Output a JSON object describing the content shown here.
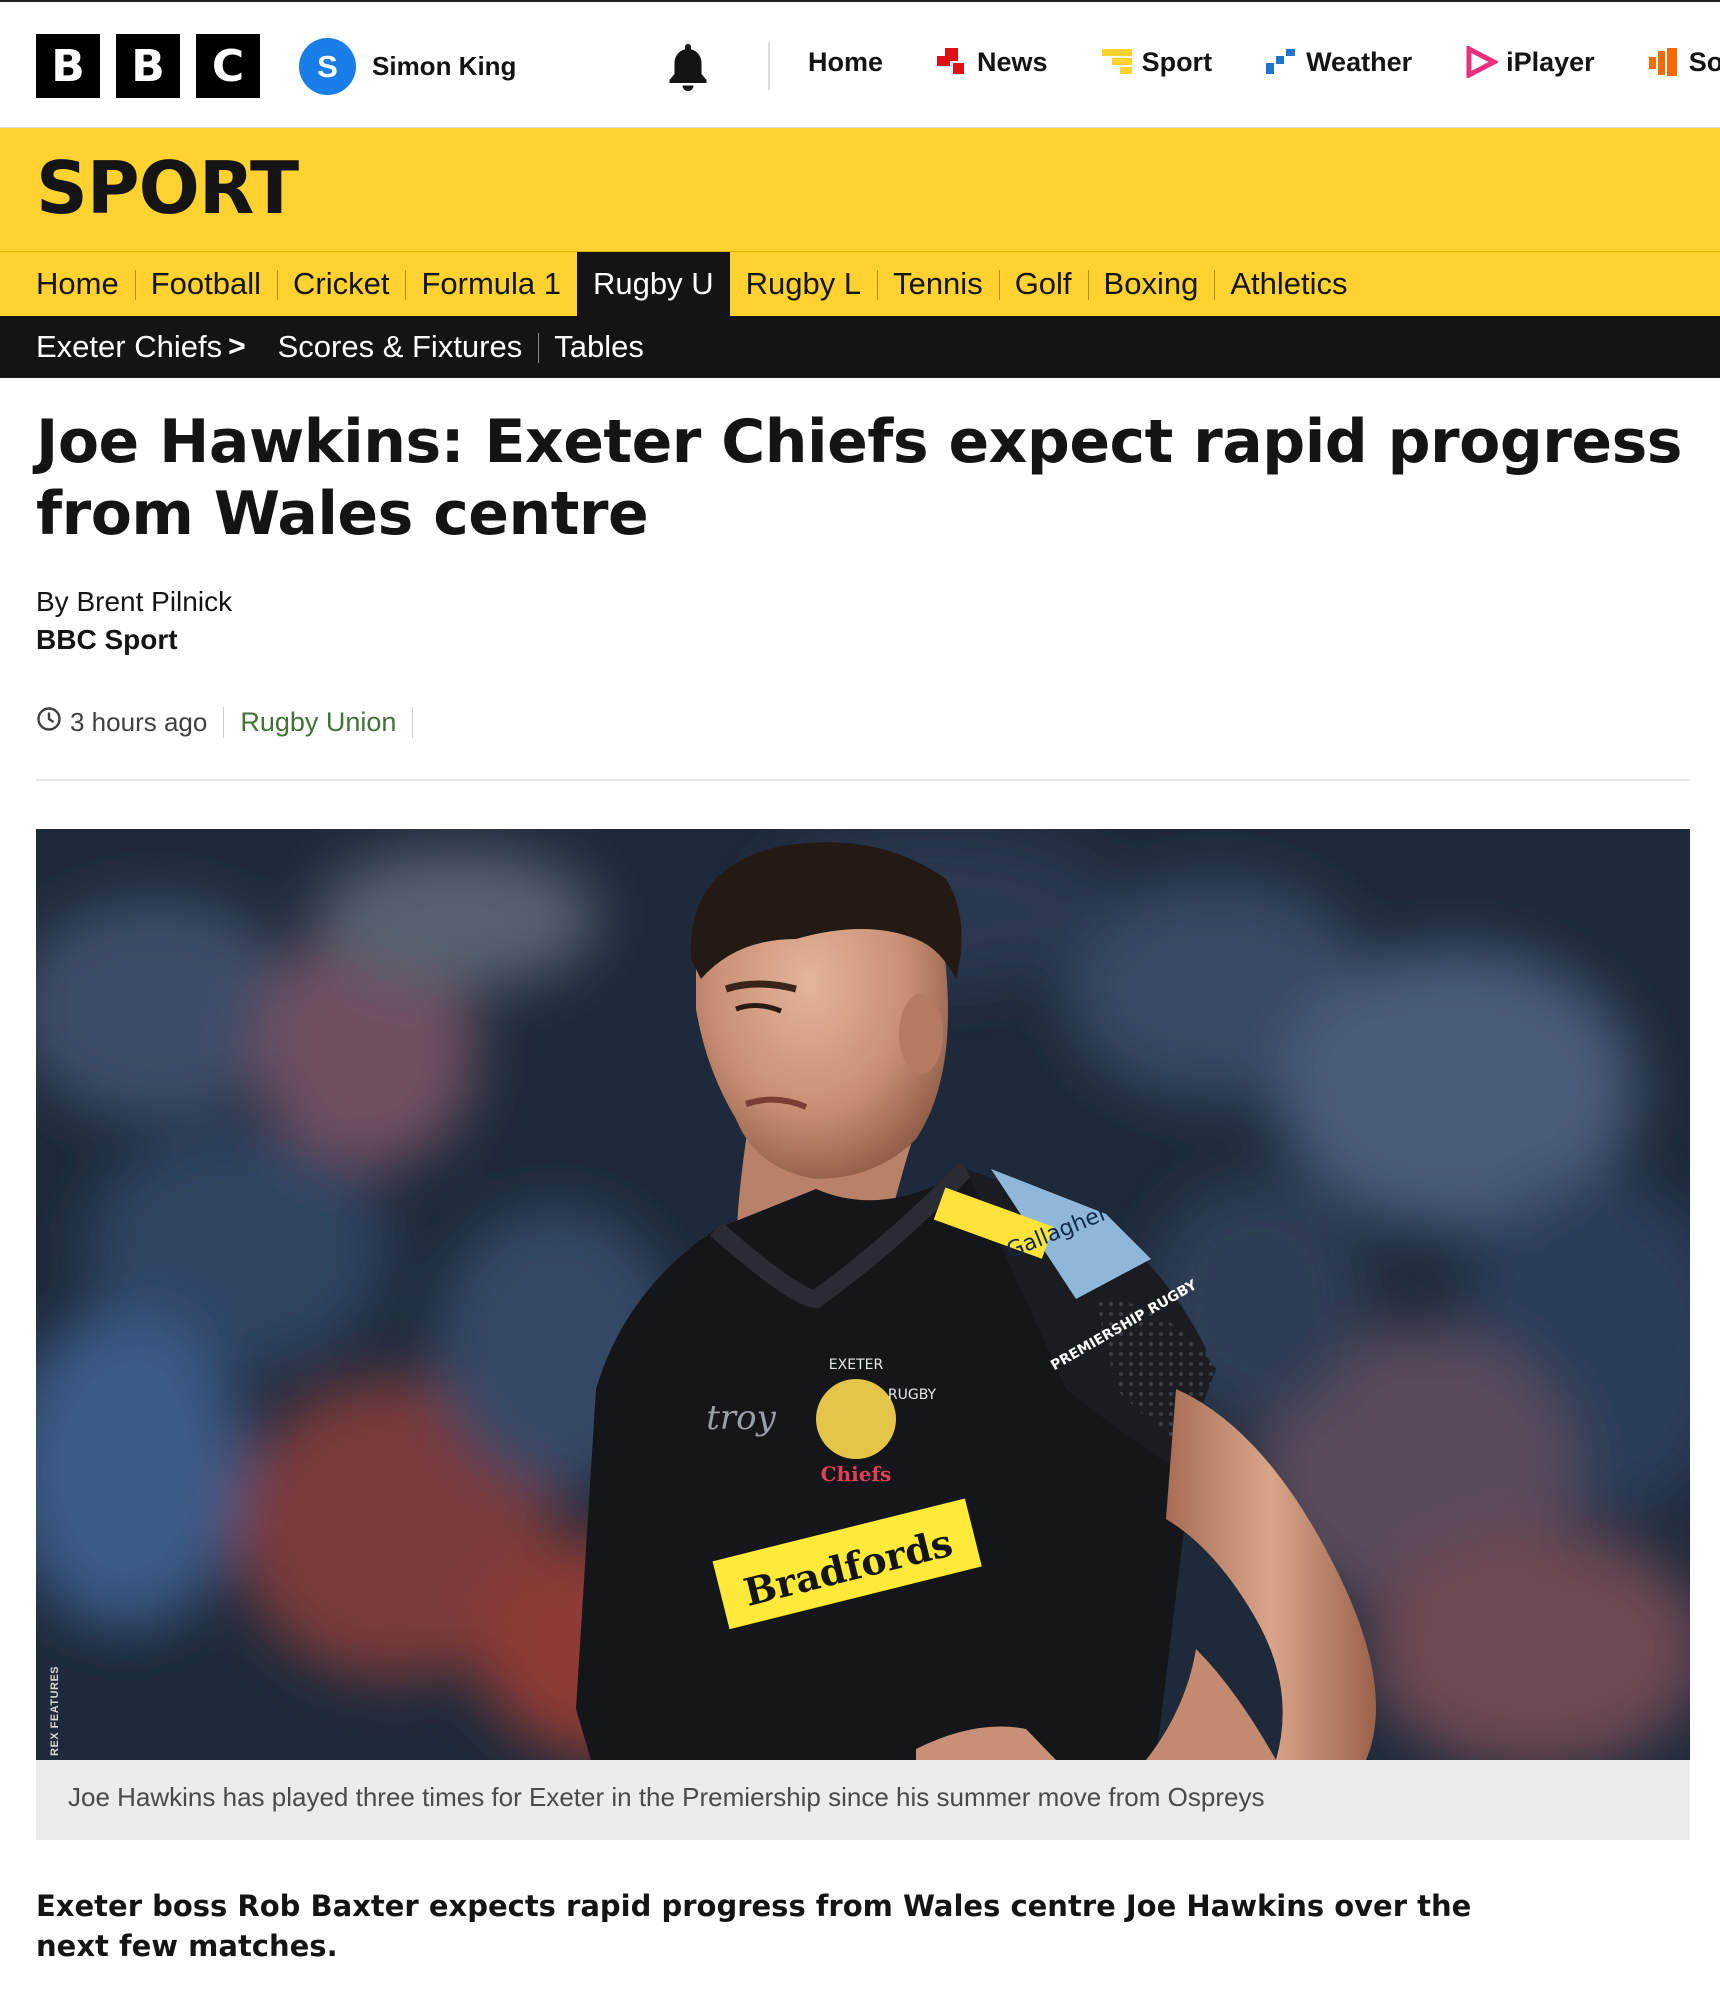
{
  "header": {
    "logo_letters": [
      "B",
      "B",
      "C"
    ],
    "account": {
      "initial": "S",
      "name": "Simon King"
    },
    "nav": [
      {
        "label": "Home",
        "icon": ""
      },
      {
        "label": "News",
        "icon": "news-icon",
        "color": "#e20f14"
      },
      {
        "label": "Sport",
        "icon": "sport-icon",
        "color": "#ffd230"
      },
      {
        "label": "Weather",
        "icon": "weather-icon",
        "color": "#1d75d1"
      },
      {
        "label": "iPlayer",
        "icon": "iplayer-icon",
        "color": "#e8317a"
      },
      {
        "label": "Sounds",
        "icon": "sounds-icon",
        "color": "#f66a00"
      }
    ]
  },
  "sport": {
    "title": "SPORT",
    "sections": [
      "Home",
      "Football",
      "Cricket",
      "Formula 1",
      "Rugby U",
      "Rugby L",
      "Tennis",
      "Golf",
      "Boxing",
      "Athletics"
    ],
    "active_section": "Rugby U",
    "subnav": {
      "team": "Exeter Chiefs",
      "links": [
        "Scores & Fixtures",
        "Tables"
      ]
    }
  },
  "article": {
    "headline": "Joe Hawkins: Exeter Chiefs expect rapid progress from Wales centre",
    "byline_author": "By Brent Pilnick",
    "byline_org": "BBC Sport",
    "time": "3 hours ago",
    "topic": "Rugby Union",
    "image_credit": "REX FEATURES",
    "image_caption": "Joe Hawkins has played three times for Exeter in the Premiership since his summer move from Ospreys",
    "summary": "Exeter boss Rob Baxter expects rapid progress from Wales centre Joe Hawkins over the next few matches.",
    "jersey": {
      "sponsor_front": "Bradfords",
      "sponsor_sleeve": "Gallagher",
      "badge_top": "EXETER",
      "badge_right": "RUGBY",
      "badge_bottom": "Chiefs",
      "script_logo": "troy",
      "league": "PREMIERSHIP RUGBY"
    }
  },
  "colors": {
    "sport_yellow": "#ffd230",
    "topic_green": "#407335",
    "account_blue": "#1a7ee8"
  }
}
